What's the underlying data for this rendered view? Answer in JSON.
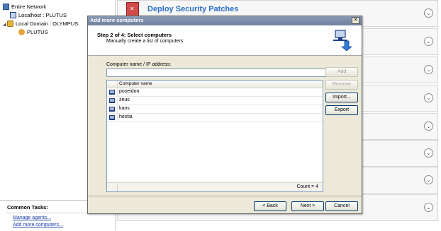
{
  "tree": {
    "items": [
      {
        "label": "Entire Network",
        "icon": "network-icon"
      },
      {
        "label": "Localhost : PLUTUS",
        "icon": "computer-icon"
      },
      {
        "label": "Local Domain : OLYMPUS",
        "icon": "domain-icon"
      },
      {
        "label": "PLUTUS",
        "icon": "agent-icon"
      }
    ]
  },
  "common_tasks": {
    "title": "Common Tasks:",
    "links": [
      "Manage agents...",
      "Add more computers..."
    ]
  },
  "background": {
    "deploy_title": "Deploy Security Patches",
    "chevron_glyph": "⌄"
  },
  "dialog": {
    "title": "Add more computers",
    "close_glyph": "✕",
    "step_title": "Step 2 of 4: Select computers",
    "step_subtitle": "Manually create a list of computers",
    "name_label": "Computer name / IP address:",
    "name_value": "",
    "buttons": {
      "add": "Add",
      "remove": "Remove",
      "import": "Import...",
      "export": "Export"
    },
    "list": {
      "column_header": "Computer name",
      "rows": [
        "poseidon",
        "zeus",
        "kaos",
        "hestia"
      ],
      "count_label": "Count = 4"
    },
    "nav": {
      "back": "< Back",
      "next": "Next >",
      "cancel": "Cancel"
    }
  },
  "colors": {
    "accent": "#2b6fc5",
    "dialog_bg": "#ece9d8",
    "titlebar": "#7586a5"
  }
}
